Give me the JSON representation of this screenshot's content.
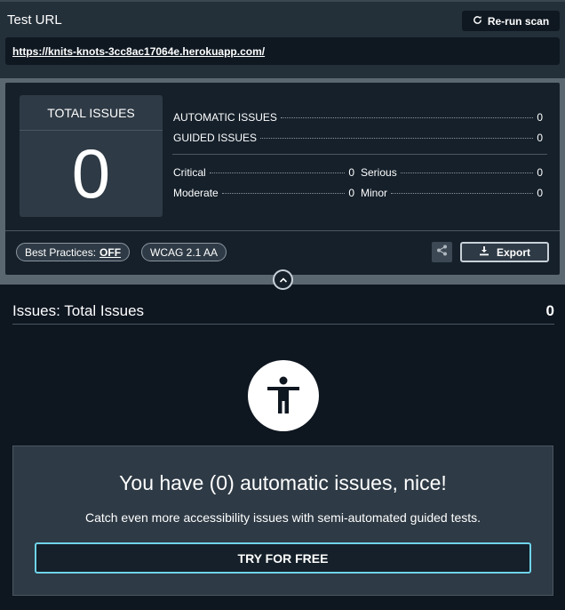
{
  "header": {
    "test_url_label": "Test URL",
    "rerun_label": "Re-run scan",
    "url": "https://knits-knots-3cc8ac17064e.herokuapp.com/"
  },
  "summary": {
    "total_label": "TOTAL ISSUES",
    "total_value": "0",
    "automatic_label": "AUTOMATIC ISSUES",
    "automatic_value": "0",
    "guided_label": "GUIDED ISSUES",
    "guided_value": "0",
    "critical_label": "Critical",
    "critical_value": "0",
    "serious_label": "Serious",
    "serious_value": "0",
    "moderate_label": "Moderate",
    "moderate_value": "0",
    "minor_label": "Minor",
    "minor_value": "0",
    "best_practices_label": "Best Practices:",
    "best_practices_value": "OFF",
    "wcag_label": "WCAG 2.1 AA",
    "export_label": "Export"
  },
  "issues": {
    "title": "Issues: Total Issues",
    "count": "0",
    "nice_title": "You have (0) automatic issues, nice!",
    "nice_sub": "Catch even more accessibility issues with semi-automated guided tests.",
    "try_label": "TRY FOR FREE"
  },
  "icons": {
    "rerun": "refresh-icon",
    "share": "share-icon",
    "export": "download-icon",
    "collapse": "chevron-up-icon",
    "accessibility": "accessibility-icon"
  },
  "colors": {
    "background": "#0e1620",
    "panel": "#2e3a45",
    "accent": "#6fd3ea"
  }
}
